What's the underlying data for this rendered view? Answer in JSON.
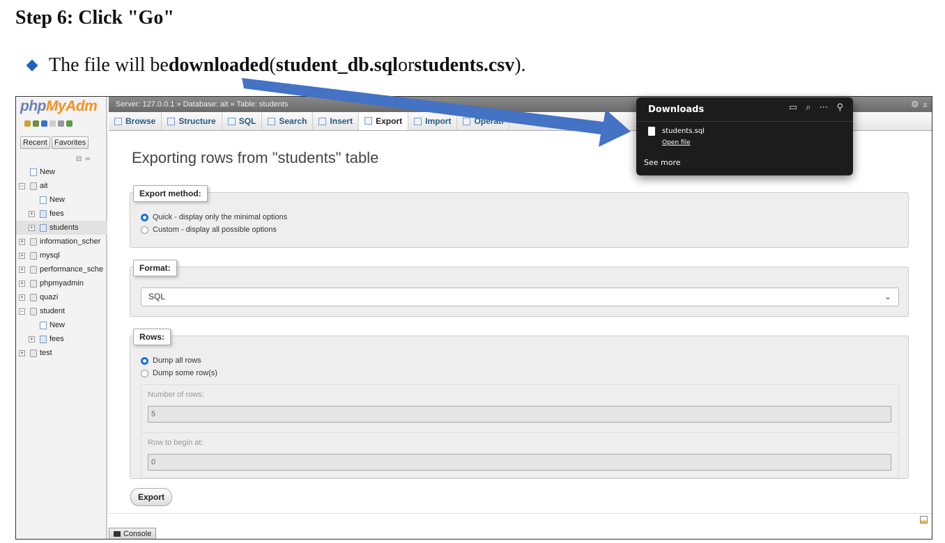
{
  "slide": {
    "title": "Step 6: Click \"Go\"",
    "bullet_pre": "The file will be ",
    "bullet_b1": "downloaded",
    "bullet_mid1": " (",
    "bullet_b2": "student_db.sql",
    "bullet_mid2": " or ",
    "bullet_b3": "students.csv",
    "bullet_end": ")."
  },
  "sidebar": {
    "logo_a": "php",
    "logo_b": "MyAdm",
    "recent_label": "Recent",
    "favorites_label": "Favorites",
    "collapse_label": "⊟ ∞",
    "tree": [
      {
        "label": "New",
        "type": "new",
        "level": 0
      },
      {
        "label": "ait",
        "type": "db",
        "level": 0,
        "expander": "−"
      },
      {
        "label": "New",
        "type": "new",
        "level": 1
      },
      {
        "label": "fees",
        "type": "tbl",
        "level": 1,
        "expander": "+"
      },
      {
        "label": "students",
        "type": "tbl",
        "level": 1,
        "expander": "+",
        "selected": true
      },
      {
        "label": "information_scher",
        "type": "db",
        "level": 0,
        "expander": "+"
      },
      {
        "label": "mysql",
        "type": "db",
        "level": 0,
        "expander": "+"
      },
      {
        "label": "performance_sche",
        "type": "db",
        "level": 0,
        "expander": "+"
      },
      {
        "label": "phpmyadmin",
        "type": "db",
        "level": 0,
        "expander": "+"
      },
      {
        "label": "quazi",
        "type": "db",
        "level": 0,
        "expander": "+"
      },
      {
        "label": "student",
        "type": "db",
        "level": 0,
        "expander": "−"
      },
      {
        "label": "New",
        "type": "new",
        "level": 1
      },
      {
        "label": "fees",
        "type": "tbl",
        "level": 1,
        "expander": "+"
      },
      {
        "label": "test",
        "type": "db",
        "level": 0,
        "expander": "+"
      }
    ]
  },
  "topbar": {
    "breadcrumb": "Server: 127.0.0.1 » Database: ait » Table: students"
  },
  "tabs": [
    {
      "label": "Browse",
      "active": false
    },
    {
      "label": "Structure",
      "active": false
    },
    {
      "label": "SQL",
      "active": false
    },
    {
      "label": "Search",
      "active": false
    },
    {
      "label": "Insert",
      "active": false
    },
    {
      "label": "Export",
      "active": true
    },
    {
      "label": "Import",
      "active": false
    },
    {
      "label": "Operati",
      "active": false
    }
  ],
  "main": {
    "page_title": "Exporting rows from \"students\" table",
    "export_method": {
      "legend": "Export method:",
      "options": [
        "Quick - display only the minimal options",
        "Custom - display all possible options"
      ],
      "selected": 0
    },
    "format": {
      "legend": "Format:",
      "value": "SQL"
    },
    "rows": {
      "legend": "Rows:",
      "options": [
        "Dump all rows",
        "Dump some row(s)"
      ],
      "selected": 0,
      "number_label": "Number of rows:",
      "number_value": "5",
      "begin_label": "Row to begin at:",
      "begin_value": "0"
    },
    "export_button": "Export",
    "console_label": "Console"
  },
  "downloads": {
    "title": "Downloads",
    "file_name": "students.sql",
    "open_file": "Open file",
    "see_more": "See more"
  },
  "colors": {
    "arrow": "#4472c4",
    "accent_link": "#235a81",
    "logo_php": "#6c7fb5",
    "logo_myadmin": "#f39020"
  }
}
